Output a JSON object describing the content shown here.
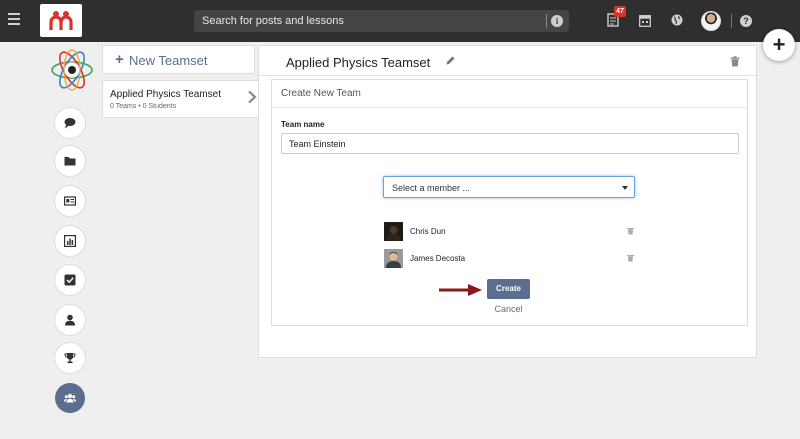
{
  "topbar": {
    "search_placeholder": "Search for posts and lessons",
    "notification_count": "47",
    "icons": [
      "menu-icon",
      "notifications-icon",
      "calendar-icon",
      "globe-icon",
      "help-icon"
    ]
  },
  "colors": {
    "topbar": "#2f2f2f",
    "accent": "#5b6e8f",
    "badge": "#d9322b",
    "arrow": "#8b1a1a",
    "focus": "#66a3e0"
  },
  "sidebar": {
    "items": [
      {
        "icon": "chat-icon"
      },
      {
        "icon": "folder-icon"
      },
      {
        "icon": "id-card-icon"
      },
      {
        "icon": "bar-chart-icon"
      },
      {
        "icon": "check-square-icon"
      },
      {
        "icon": "user-icon"
      },
      {
        "icon": "trophy-icon"
      },
      {
        "icon": "users-icon",
        "active": true
      }
    ]
  },
  "teamsets": {
    "new_label": "New Teamset",
    "items": [
      {
        "name": "Applied Physics Teamset",
        "meta": "0 Teams • 0 Students"
      }
    ]
  },
  "main": {
    "title": "Applied Physics Teamset",
    "form": {
      "title": "Create New Team",
      "team_name_label": "Team name",
      "team_name_value": "Team Einstein",
      "member_select_value": "Select a member ...",
      "members": [
        {
          "name": "Chris Dun"
        },
        {
          "name": "James Decosta"
        }
      ],
      "create_label": "Create",
      "cancel_label": "Cancel"
    }
  }
}
